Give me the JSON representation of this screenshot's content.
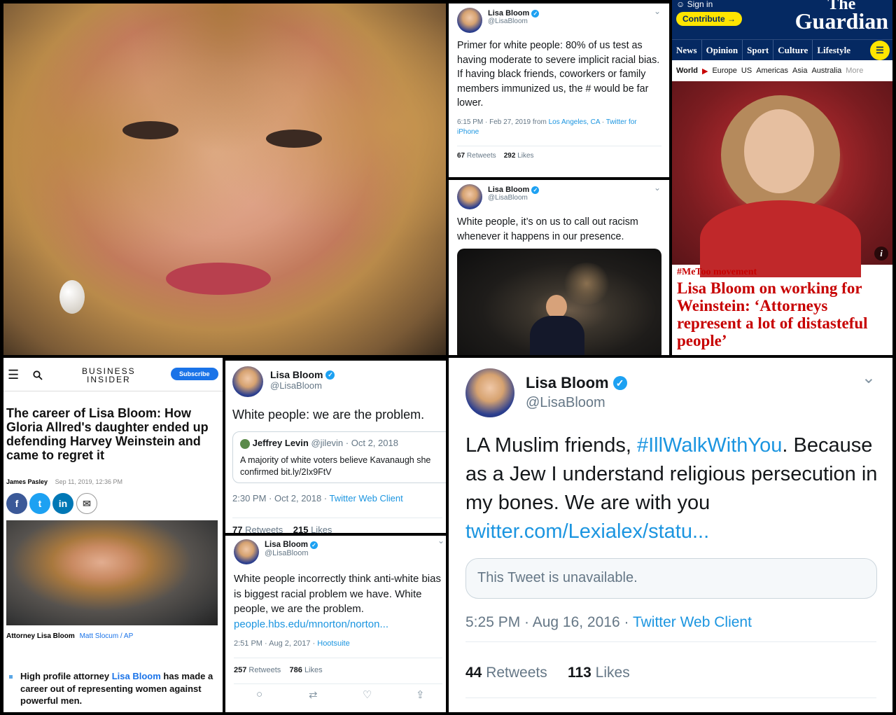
{
  "tweet_feb2019": {
    "name": "Lisa Bloom",
    "handle": "@LisaBloom",
    "text": "Primer for white people: 80% of us test as having moderate to severe implicit racial bias. If having black friends, coworkers or family members immunized us, the # would be far lower.",
    "meta_time": "6:15 PM · Feb 27, 2019 from ",
    "meta_location": "Los Angeles, CA",
    "meta_sep": " · ",
    "meta_client": "Twitter for iPhone",
    "retweets": "67",
    "retweets_label": "Retweets",
    "likes": "292",
    "likes_label": "Likes"
  },
  "tweet_racism": {
    "name": "Lisa Bloom",
    "handle": "@LisaBloom",
    "text": "White people, it’s on us to call out racism whenever it happens in our presence."
  },
  "guardian": {
    "sign_in": "Sign in",
    "contribute": "Contribute →",
    "logo_line1": "The",
    "logo_line2": "Guardian",
    "nav": [
      "News",
      "Opinion",
      "Sport",
      "Culture",
      "Lifestyle"
    ],
    "subnav_current": "World",
    "subnav": [
      "Europe",
      "US",
      "Americas",
      "Asia",
      "Australia"
    ],
    "subnav_more": "More",
    "kicker": "#MeToo movement",
    "headline": "Lisa Bloom on working for Weinstein: ‘Attorneys represent a lot of distasteful people’",
    "info_icon": "i"
  },
  "business_insider": {
    "logo_line1": "BUSINESS",
    "logo_line2": "INSIDER",
    "subscribe": "Subscribe",
    "headline": "The career of Lisa Bloom: How Gloria Allred's daughter ended up defending Harvey Weinstein and came to regret it",
    "author": "James Pasley",
    "date": "Sep 11, 2019, 12:36 PM",
    "caption": "Attorney Lisa Bloom",
    "credit": "Matt Slocum / AP",
    "bullet_pre": "High profile attorney ",
    "bullet_link": "Lisa Bloom",
    "bullet_post": " has made a career out of representing women against powerful men.",
    "social": [
      "f",
      "t",
      "in",
      "✉"
    ],
    "colors": {
      "facebook": "#3b5998",
      "twitter": "#1da1f2",
      "linkedin": "#0077b5",
      "accent": "#1a73e8"
    }
  },
  "tweet_problem": {
    "name": "Lisa Bloom",
    "handle": "@LisaBloom",
    "text": "White people: we are the problem.",
    "quote_name": "Jeffrey Levin",
    "quote_handle": "@jilevin",
    "quote_date": "· Oct 2, 2018",
    "quote_text": "A majority of white voters believe Kavanaugh she",
    "quote_text2": "confirmed bit.ly/2Ix9FtV",
    "meta_time": "2:30 PM · Oct 2, 2018 · ",
    "meta_client": "Twitter Web Client",
    "retweets": "77",
    "retweets_label": "Retweets",
    "likes": "215",
    "likes_label": "Likes"
  },
  "tweet_antiwhite": {
    "name": "Lisa Bloom",
    "handle": "@LisaBloom",
    "text": "White people incorrectly think anti-white bias is biggest racial problem we have. White people, we are the problem.",
    "link": "people.hbs.edu/mnorton/norton...",
    "meta_time": "2:51 PM · Aug 2, 2017 · ",
    "meta_client": "Hootsuite",
    "retweets": "257",
    "retweets_label": "Retweets",
    "likes": "786",
    "likes_label": "Likes"
  },
  "tweet_muslim": {
    "name": "Lisa Bloom",
    "handle": "@LisaBloom",
    "text_pre": "LA Muslim friends, ",
    "hashtag": "#IllWalkWithYou",
    "text_post": ". Because as a Jew I understand religious persecution in my bones. We are with you ",
    "link": "twitter.com/Lexialex/statu...",
    "unavailable": "This Tweet is unavailable.",
    "meta_time": "5:25 PM · Aug 16, 2016 · ",
    "meta_client": "Twitter Web Client",
    "retweets": "44",
    "retweets_label": "Retweets",
    "likes": "113",
    "likes_label": "Likes"
  }
}
